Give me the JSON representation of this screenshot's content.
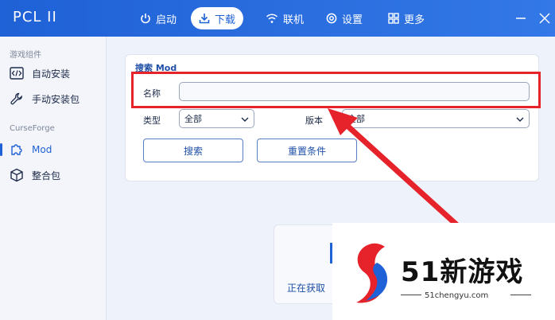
{
  "app": {
    "title": "PCL II"
  },
  "nav": {
    "launch": "启动",
    "download": "下载",
    "online": "联机",
    "settings": "设置",
    "more": "更多"
  },
  "sidebar": {
    "section_game_components": "游戏组件",
    "auto_install": "自动安装",
    "manual_install": "手动安装包",
    "section_curseforge": "CurseForge",
    "mod": "Mod",
    "modpack": "整合包"
  },
  "search_card": {
    "title": "搜索 Mod",
    "name_label": "名称",
    "name_value": "",
    "type_label": "类型",
    "type_value": "全部",
    "version_label": "版本",
    "version_value": "全部",
    "search_button": "搜索",
    "reset_button": "重置条件"
  },
  "loading": {
    "text": "正在获取"
  },
  "watermark": {
    "brand": "51新游戏",
    "url": "51chengyu.com"
  },
  "colors": {
    "accent": "#1f61d6",
    "highlight": "#e6222b"
  }
}
